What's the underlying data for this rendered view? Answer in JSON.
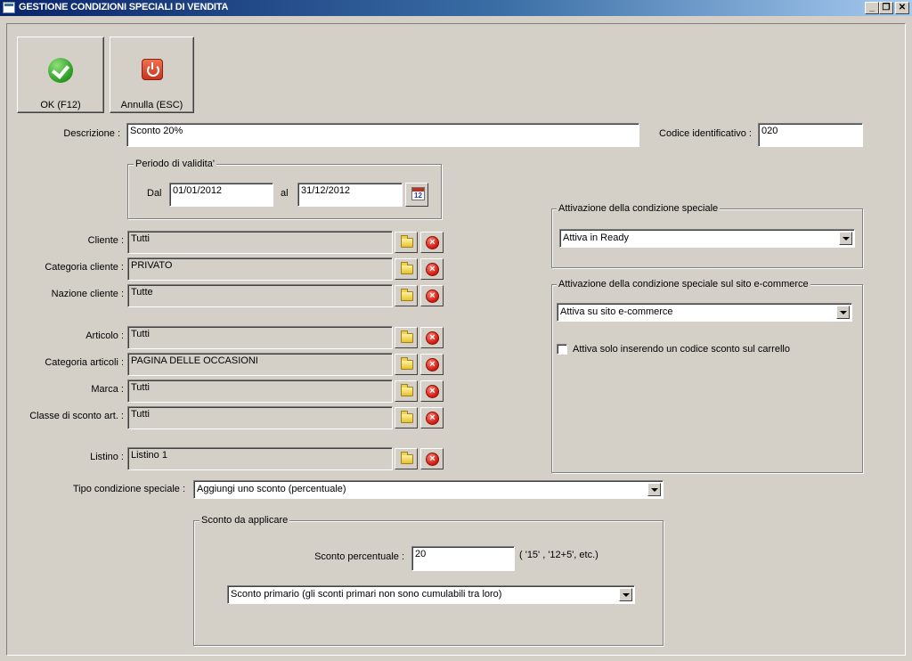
{
  "window": {
    "title": "GESTIONE CONDIZIONI SPECIALI DI VENDITA",
    "controls": [
      "minimize-icon",
      "restore-icon",
      "close-icon"
    ]
  },
  "toolbar": {
    "ok_label": "OK (F12)",
    "cancel_label": "Annulla (ESC)"
  },
  "form": {
    "descrizione": {
      "label": "Descrizione :",
      "value": "Sconto 20%"
    },
    "codice": {
      "label": "Codice identificativo :",
      "value": "020"
    },
    "periodo": {
      "legend": "Periodo di validita'",
      "dal_label": "Dal",
      "dal_value": "01/01/2012",
      "al_label": "al",
      "al_value": "31/12/2012"
    },
    "fields": [
      {
        "label": "Cliente :",
        "value": "Tutti"
      },
      {
        "label": "Categoria cliente :",
        "value": "PRIVATO"
      },
      {
        "label": "Nazione cliente :",
        "value": "Tutte"
      },
      {
        "label": "Articolo :",
        "value": "Tutti"
      },
      {
        "label": "Categoria articoli :",
        "value": "PAGINA DELLE OCCASIONI"
      },
      {
        "label": "Marca :",
        "value": "Tutti"
      },
      {
        "label": "Classe di sconto art. :",
        "value": "Tutti"
      },
      {
        "label": "Listino :",
        "value": "Listino 1"
      }
    ],
    "tipo": {
      "label": "Tipo condizione speciale :",
      "value": "Aggiungi uno sconto (percentuale)"
    },
    "sconto": {
      "legend": "Sconto da applicare",
      "perc_label": "Sconto percentuale :",
      "perc_value": "20",
      "hint": "( '15' ,  '12+5', etc.)",
      "tipo_value": "Sconto primario (gli sconti primari non sono cumulabili tra loro)"
    }
  },
  "attivazione": {
    "legend": "Attivazione della condizione speciale",
    "value": "Attiva in Ready"
  },
  "ecommerce": {
    "legend": "Attivazione della condizione speciale sul sito e-commerce",
    "value": "Attiva su sito e-commerce",
    "checkbox_label": "Attiva solo inserendo un codice sconto sul carrello",
    "checkbox_checked": false
  }
}
